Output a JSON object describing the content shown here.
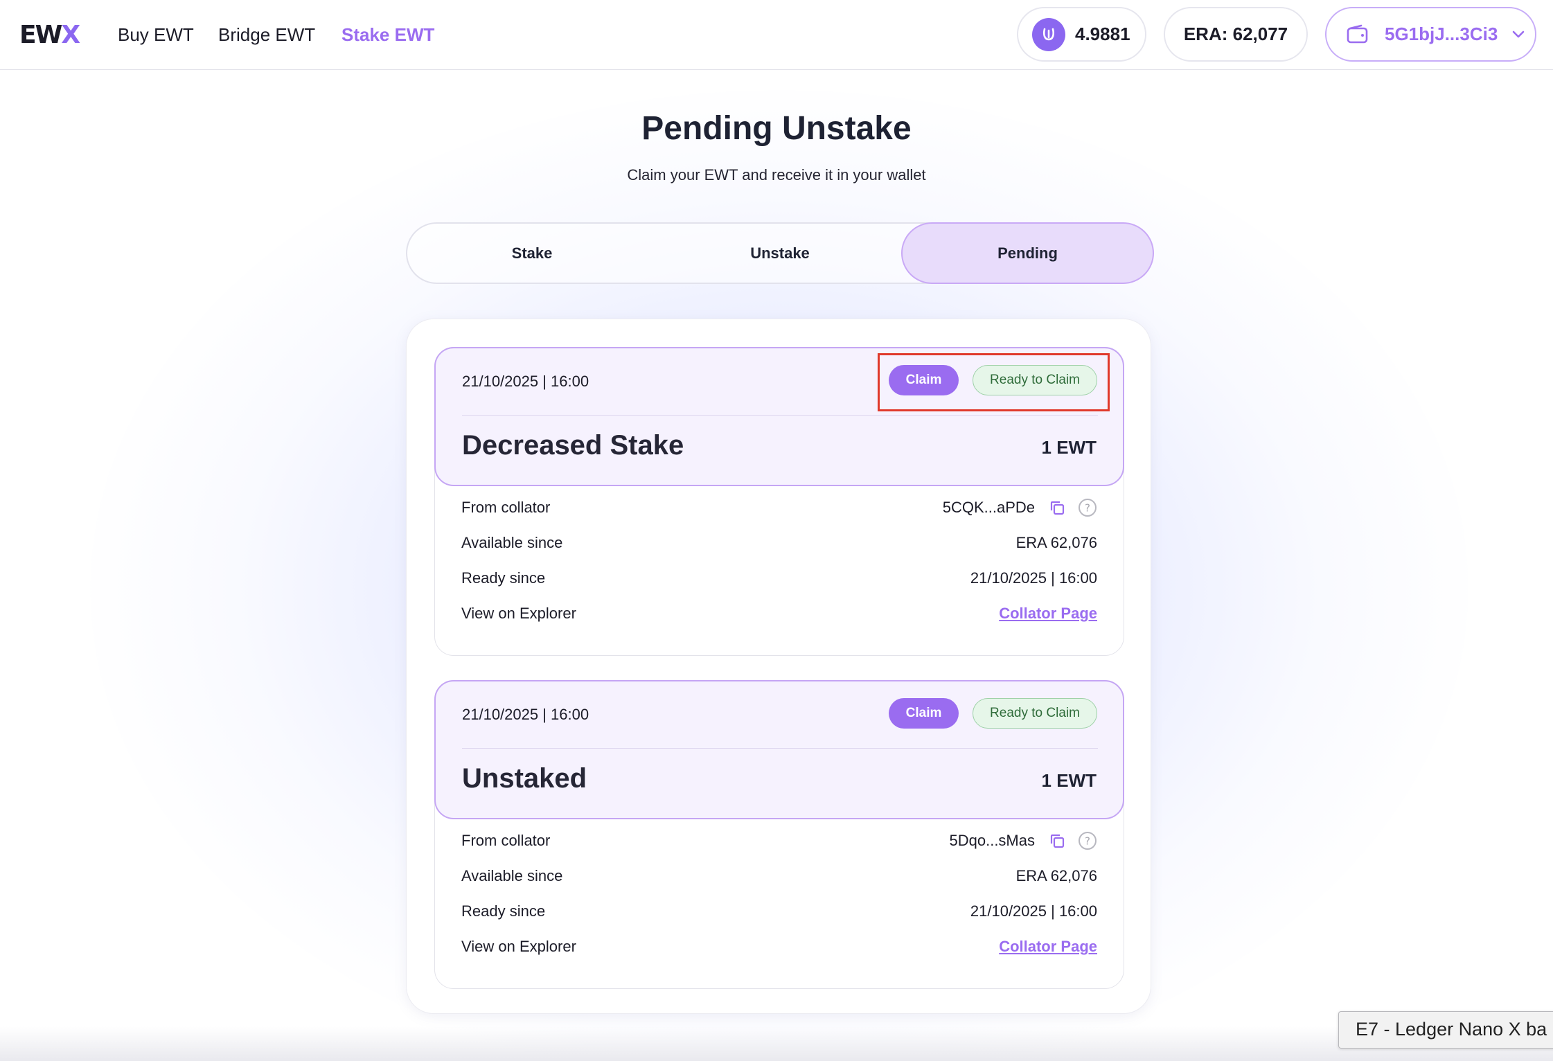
{
  "header": {
    "logo": {
      "main": "EW",
      "accent": "X"
    },
    "nav": [
      "Buy EWT",
      "Bridge EWT",
      "Stake EWT"
    ],
    "balance": "4.9881",
    "era": "ERA: 62,077",
    "wallet": "5G1bjJ...3Ci3"
  },
  "page": {
    "title": "Pending Unstake",
    "subtitle": "Claim your EWT and receive it in your wallet"
  },
  "tabs": [
    "Stake",
    "Unstake",
    "Pending"
  ],
  "cards": [
    {
      "date": "21/10/2025 | 16:00",
      "claim_label": "Claim",
      "status": "Ready to Claim",
      "kind": "Decreased Stake",
      "amount": "1 EWT",
      "rows": [
        {
          "label": "From collator",
          "value": "5CQK...aPDe"
        },
        {
          "label": "Available since",
          "value": "ERA 62,076"
        },
        {
          "label": "Ready since",
          "value": "21/10/2025 | 16:00"
        },
        {
          "label": "View on Explorer",
          "value": "Collator Page"
        }
      ]
    },
    {
      "date": "21/10/2025 | 16:00",
      "claim_label": "Claim",
      "status": "Ready to Claim",
      "kind": "Unstaked",
      "amount": "1 EWT",
      "rows": [
        {
          "label": "From collator",
          "value": "5Dqo...sMas"
        },
        {
          "label": "Available since",
          "value": "ERA 62,076"
        },
        {
          "label": "Ready since",
          "value": "21/10/2025 | 16:00"
        },
        {
          "label": "View on Explorer",
          "value": "Collator Page"
        }
      ]
    }
  ],
  "tooltip": "E7 - Ledger Nano X ba",
  "colors": {
    "accent": "#9a6cf0",
    "status_bg": "#e6f6e9",
    "status_text": "#2f6c3a",
    "highlight": "#e0392b"
  },
  "icons": [
    "ewx-logo",
    "coin-icon",
    "wallet-icon",
    "chevron-down-icon",
    "copy-icon",
    "help-icon"
  ]
}
